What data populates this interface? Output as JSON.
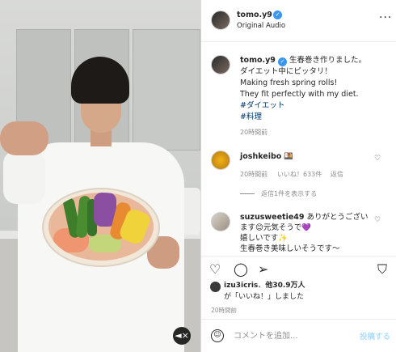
{
  "header": {
    "username": "tomo.y9",
    "subtitle": "Original Audio",
    "more_icon": "more-icon"
  },
  "caption": {
    "username": "tomo.y9",
    "line1": "生春巻き作りました。",
    "line2": "ダイエット中にピッタリ！",
    "line3": "Making fresh spring rolls!",
    "line4": "They fit perfectly with my diet.",
    "tag1": "#ダイエット",
    "tag2": "#料理",
    "time": "20時間前"
  },
  "comments": [
    {
      "username": "joshkeibo",
      "text": "🍱",
      "time": "20時間前",
      "likes": "いいね！633件",
      "reply": "返信"
    },
    {
      "username": "suzusweetie49",
      "text_line1": "ありがとうござい",
      "text_line2": "ます😊元気そうで💜",
      "text_line3": "嬉しいです✨",
      "text_line4": "生春巻き美味しいそうです〜"
    }
  ],
  "replies_link": "返信1件を表示する",
  "likes": {
    "bold_user": "izu3icris",
    "others": "他30.9万人",
    "suffix": "が「いいね！」しました"
  },
  "post_time": "20時間前",
  "comment_box": {
    "placeholder": "コメントを追加...",
    "post_label": "投稿する"
  },
  "colors": {
    "accent": "#0095f6",
    "tag": "#00376b",
    "muted": "#8e8e8e"
  }
}
